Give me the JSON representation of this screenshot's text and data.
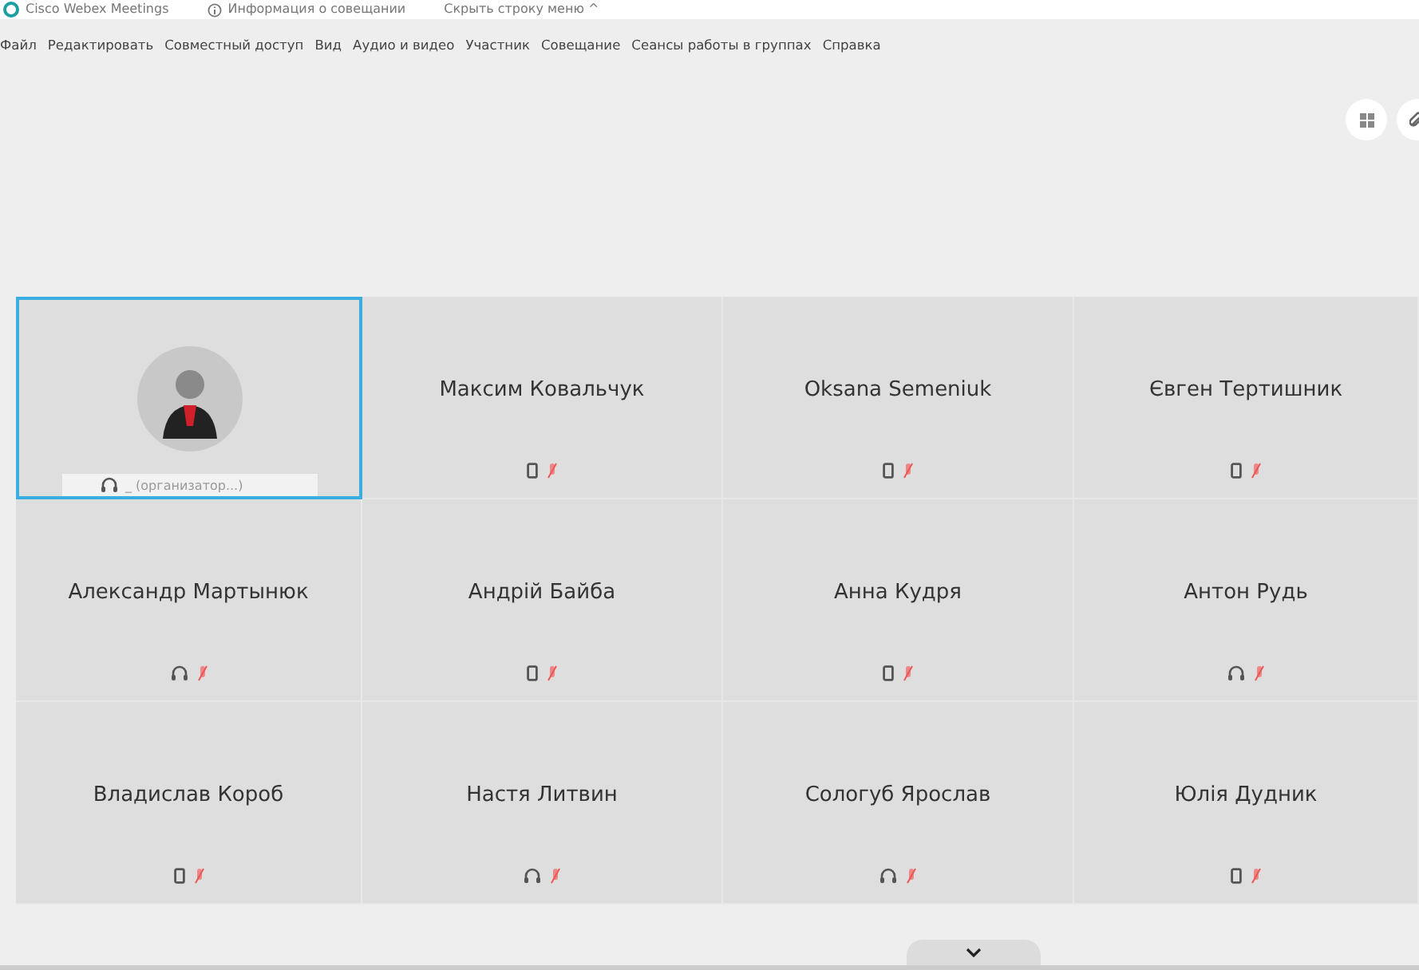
{
  "title_bar": {
    "app_name": "Cisco Webex Meetings",
    "info": "Информация о совещании",
    "hide_menu": "Скрыть строку меню ^"
  },
  "menu": [
    "Файл",
    "Редактировать",
    "Совместный доступ",
    "Вид",
    "Аудио и видео",
    "Участник",
    "Совещание",
    "Сеансы работы в группах",
    "Справка"
  ],
  "participants": [
    {
      "kind": "host",
      "name": "_ (организатор...)",
      "on_phone": false,
      "muted": false,
      "selected": true
    },
    {
      "kind": "guest",
      "name": "Максим Ковальчук",
      "on_phone": true,
      "muted": true,
      "selected": false
    },
    {
      "kind": "guest",
      "name": "Oksana Semeniuk",
      "on_phone": true,
      "muted": true,
      "selected": false
    },
    {
      "kind": "guest",
      "name": "Євген Тертишник",
      "on_phone": true,
      "muted": true,
      "selected": false
    },
    {
      "kind": "guest",
      "name": "Александр Мартынюк",
      "on_phone": false,
      "muted": true,
      "selected": false
    },
    {
      "kind": "guest",
      "name": "Андрій Байба",
      "on_phone": true,
      "muted": true,
      "selected": false
    },
    {
      "kind": "guest",
      "name": "Анна Кудря",
      "on_phone": true,
      "muted": true,
      "selected": false
    },
    {
      "kind": "guest",
      "name": "Антон Рудь",
      "on_phone": false,
      "muted": true,
      "selected": false
    },
    {
      "kind": "guest",
      "name": "Владислав Короб",
      "on_phone": true,
      "muted": true,
      "selected": false
    },
    {
      "kind": "guest",
      "name": "Настя Литвин",
      "on_phone": false,
      "muted": true,
      "selected": false
    },
    {
      "kind": "guest",
      "name": "Сологуб Ярослав",
      "on_phone": false,
      "muted": true,
      "selected": false
    },
    {
      "kind": "guest",
      "name": "Юлія Дудник",
      "on_phone": true,
      "muted": true,
      "selected": false
    }
  ]
}
